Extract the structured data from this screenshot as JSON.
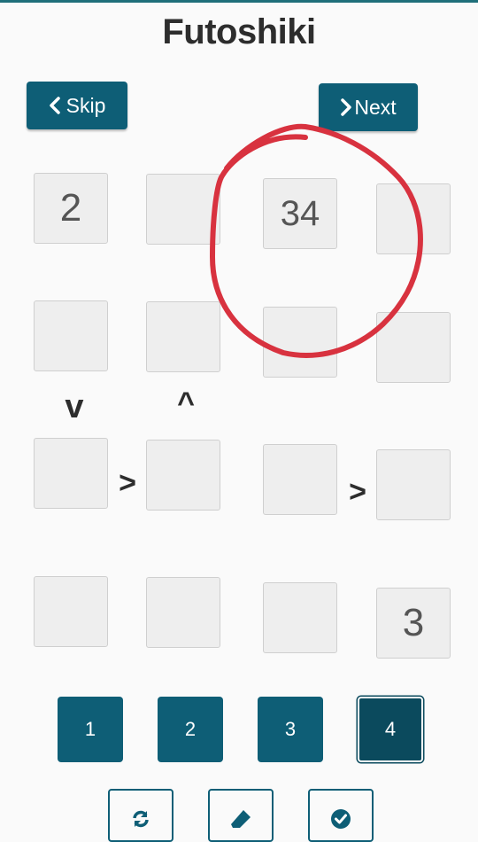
{
  "title": "Futoshiki",
  "nav": {
    "skip_label": "Skip",
    "next_label": "Next"
  },
  "grid": {
    "rows": [
      [
        "2",
        "",
        "34",
        ""
      ],
      [
        "",
        "",
        "",
        ""
      ],
      [
        "",
        "",
        "",
        ""
      ],
      [
        "",
        "",
        "",
        "3"
      ]
    ],
    "constraints": {
      "r1_c0_vertical": "v",
      "r1_c1_vertical": "^",
      "r2_c0_c1": ">",
      "r2_c2_c3": ">"
    }
  },
  "number_pad": {
    "buttons": [
      "1",
      "2",
      "3",
      "4"
    ],
    "selected": "4"
  },
  "tools": {
    "icons": [
      "refresh-icon",
      "eraser-icon",
      "check-icon"
    ]
  },
  "colors": {
    "accent": "#0e5e76",
    "annotation": "#d8323f"
  }
}
